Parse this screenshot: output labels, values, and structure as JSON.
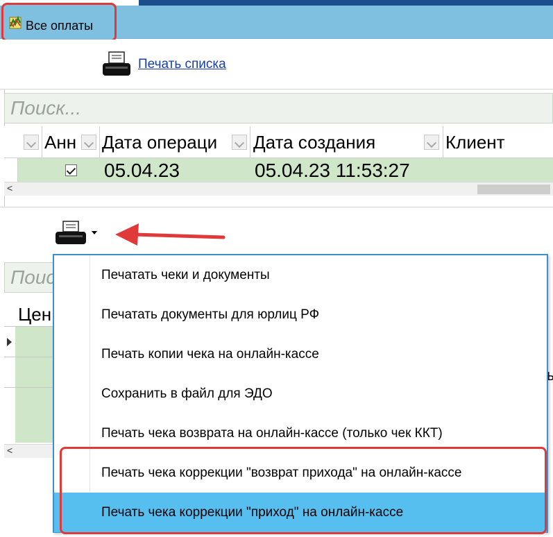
{
  "window": {
    "title": "Все оплаты",
    "title_icon": "app-chart-icon"
  },
  "toolbar": {
    "print_list_label": "Печать списка",
    "print_icon": "printer-icon"
  },
  "grid_top": {
    "search_placeholder": "Поиск...",
    "columns": [
      "Анн",
      "Дата операци",
      "Дата создания",
      "Клиент"
    ],
    "row": {
      "annulled": true,
      "operation_date": "05.04.23",
      "created_at": "05.04.23 11:53:27",
      "client": ""
    },
    "scroll_left_glyph": "<"
  },
  "print_dropdown": {
    "icon": "printer-icon",
    "items": [
      "Печатать чеки и документы",
      "Печатать документы для юрлиц РФ",
      "Печать копии чека на онлайн-кассе",
      "Сохранить в файл для ЭДО",
      "Печать чека возврата на онлайн-кассе (только чек ККТ)",
      "Печать чека коррекции \"возврат прихода\" на онлайн-кассе",
      "Печать чека коррекции \"приход\" на онлайн-кассе"
    ],
    "highlighted_index": 6
  },
  "grid_bottom": {
    "search_placeholder": "Поис",
    "first_column": "Цен",
    "right_clip": "ы",
    "scroll_left_glyph": "<"
  },
  "colors": {
    "titlebar": "#7fbfe0",
    "accent_red": "#e0393a",
    "row_green": "#cfe6c9",
    "menu_highlight": "#56bff0",
    "menu_border": "#3d8fd0",
    "link": "#1a3ea8"
  }
}
